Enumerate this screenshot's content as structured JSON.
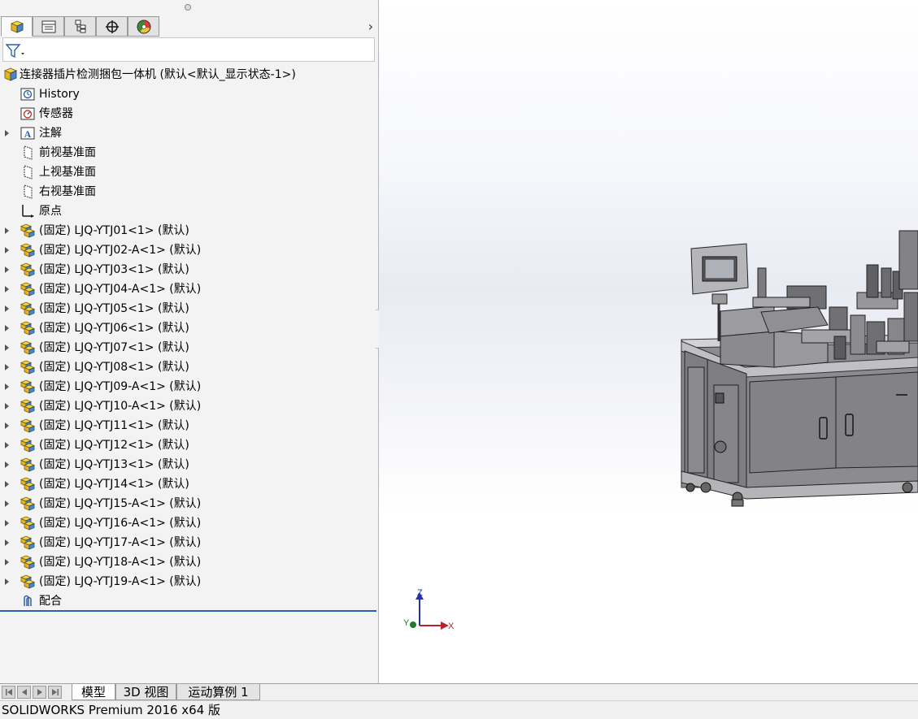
{
  "panel_tabs": [
    "featuremanager-tab",
    "propertymanager-tab",
    "configurationmanager-tab",
    "dimxpert-tab",
    "display-manager-tab"
  ],
  "tree": {
    "root": "连接器插片检测捆包一体机  (默认<默认_显示状态-1>)",
    "history": "History",
    "sensors": "传感器",
    "annotations": "注解",
    "front_plane": "前视基准面",
    "top_plane": "上视基准面",
    "right_plane": "右视基准面",
    "origin": "原点",
    "components": [
      "(固定) LJQ-YTJ01<1> (默认)",
      "(固定) LJQ-YTJ02-A<1> (默认)",
      "(固定) LJQ-YTJ03<1> (默认)",
      "(固定) LJQ-YTJ04-A<1> (默认)",
      "(固定) LJQ-YTJ05<1> (默认)",
      "(固定) LJQ-YTJ06<1> (默认)",
      "(固定) LJQ-YTJ07<1> (默认)",
      "(固定) LJQ-YTJ08<1> (默认)",
      "(固定) LJQ-YTJ09-A<1> (默认)",
      "(固定) LJQ-YTJ10-A<1> (默认)",
      "(固定) LJQ-YTJ11<1> (默认)",
      "(固定) LJQ-YTJ12<1> (默认)",
      "(固定) LJQ-YTJ13<1> (默认)",
      "(固定) LJQ-YTJ14<1> (默认)",
      "(固定) LJQ-YTJ15-A<1> (默认)",
      "(固定) LJQ-YTJ16-A<1> (默认)",
      "(固定) LJQ-YTJ17-A<1> (默认)",
      "(固定) LJQ-YTJ18-A<1> (默认)",
      "(固定) LJQ-YTJ19-A<1> (默认)"
    ],
    "mates": "配合"
  },
  "triad": {
    "x": "X",
    "y": "Y",
    "z": "Z"
  },
  "bottom_tabs": [
    "模型",
    "3D 视图",
    "运动算例 1"
  ],
  "status": "SOLIDWORKS Premium 2016 x64 版"
}
